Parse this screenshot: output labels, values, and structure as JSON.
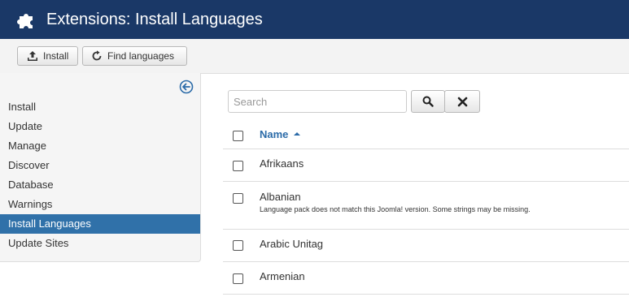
{
  "header": {
    "title": "Extensions: Install Languages",
    "icon": "puzzle-icon",
    "background": "#1a3867"
  },
  "toolbar": {
    "install_label": "Install",
    "find_languages_label": "Find languages"
  },
  "sidebar": {
    "collapse_icon": "arrow-left-circle-icon",
    "items": [
      {
        "label": "Install",
        "active": false
      },
      {
        "label": "Update",
        "active": false
      },
      {
        "label": "Manage",
        "active": false
      },
      {
        "label": "Discover",
        "active": false
      },
      {
        "label": "Database",
        "active": false
      },
      {
        "label": "Warnings",
        "active": false
      },
      {
        "label": "Install Languages",
        "active": true
      },
      {
        "label": "Update Sites",
        "active": false
      }
    ],
    "active_color": "#3071a9"
  },
  "search": {
    "placeholder": "Search",
    "value": ""
  },
  "table": {
    "header": {
      "name": "Name",
      "sort": "ascending"
    },
    "rows": [
      {
        "name": "Afrikaans",
        "note": ""
      },
      {
        "name": "Albanian",
        "note": "Language pack does not match this Joomla! version. Some strings may be missing."
      },
      {
        "name": "Arabic Unitag",
        "note": ""
      },
      {
        "name": "Armenian",
        "note": ""
      }
    ]
  }
}
